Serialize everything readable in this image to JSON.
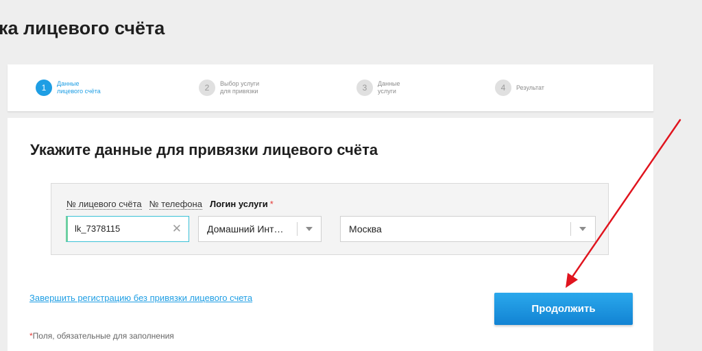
{
  "page_title": "ка лицевого счёта",
  "stepper": {
    "steps": [
      {
        "num": "1",
        "label": "Данные\nлицевого счёта",
        "active": true
      },
      {
        "num": "2",
        "label": "Выбор услуги\nдля привязки",
        "active": false
      },
      {
        "num": "3",
        "label": "Данные\nуслуги",
        "active": false
      },
      {
        "num": "4",
        "label": "Результат",
        "active": false
      }
    ]
  },
  "form": {
    "title": "Укажите данные для привязки лицевого счёта",
    "tabs": [
      "№ лицевого счёта",
      "№ телефона",
      "Логин услуги"
    ],
    "active_tab": "Логин услуги",
    "required_mark": "*",
    "account_input": {
      "value": "lk_7378115"
    },
    "service_select": {
      "value": "Домашний Инт…"
    },
    "city_select": {
      "value": "Москва"
    }
  },
  "links": {
    "skip_registration": "Завершить регистрацию без привязки лицевого счета"
  },
  "buttons": {
    "continue": "Продолжить"
  },
  "footnote": {
    "star": "*",
    "text": "Поля, обязательные для заполнения"
  },
  "colors": {
    "accent": "#1e9ee4",
    "button": "#1a8fdc",
    "required": "#e53935",
    "annotation_arrow": "#e0141e",
    "page_bg": "#eeeeee"
  },
  "icons": {
    "clear": "close-icon",
    "dropdown": "chevron-down-icon"
  }
}
